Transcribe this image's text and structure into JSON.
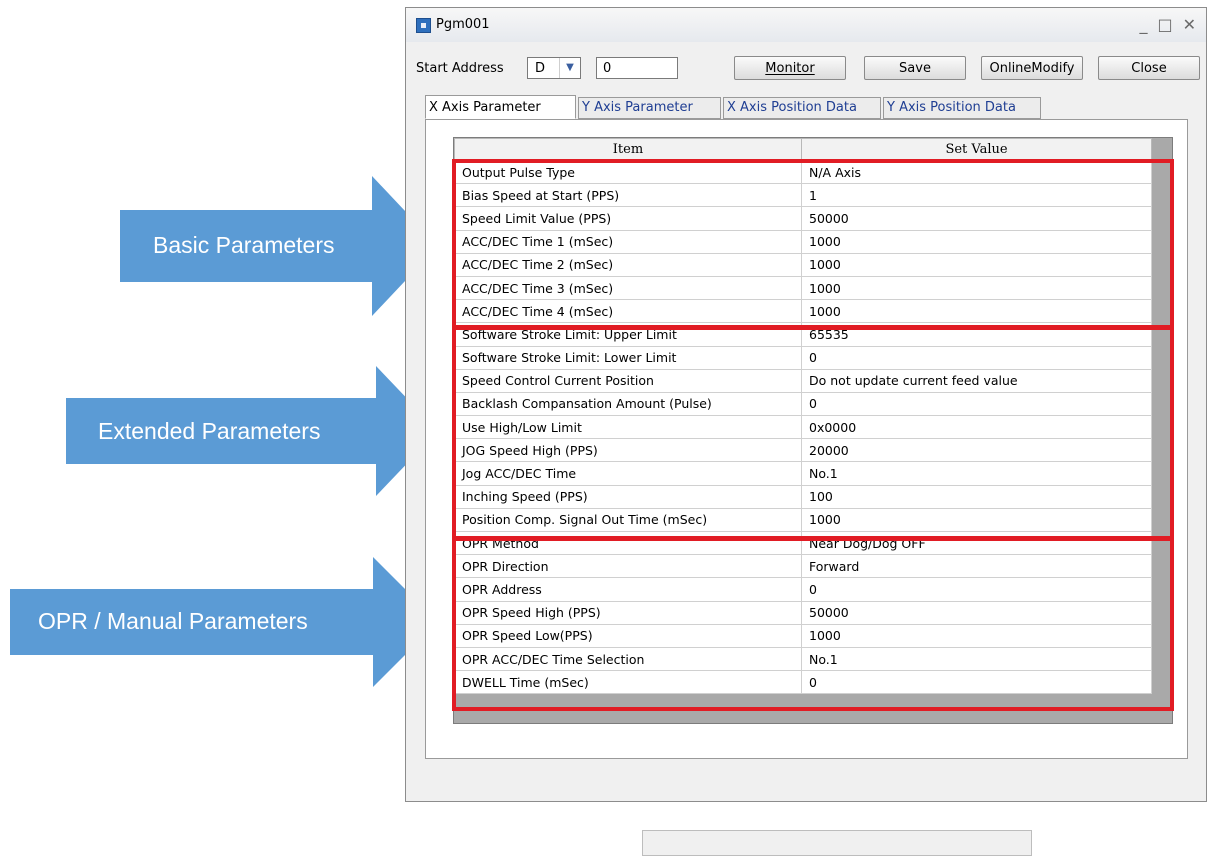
{
  "annotations": [
    {
      "label": "Basic Parameters"
    },
    {
      "label": "Extended Parameters"
    },
    {
      "label": "OPR / Manual Parameters"
    }
  ],
  "colors": {
    "arrow": "#5b9bd5",
    "highlight": "#e11c24",
    "tab_text": "#1f3e93"
  },
  "window": {
    "title": "Pgm001",
    "icon": "app-icon",
    "controls": {
      "minimize": "_",
      "maximize": "□",
      "close": "✕"
    }
  },
  "toolbar": {
    "start_address_label": "Start Address",
    "device_value": "D",
    "address_value": "0",
    "monitor_label": "Monitor",
    "save_label": "Save",
    "online_modify_label": "OnlineModify",
    "close_label": "Close"
  },
  "tabs": [
    {
      "label": "X Axis Parameter",
      "active": true
    },
    {
      "label": "Y Axis Parameter",
      "active": false
    },
    {
      "label": "X Axis Position Data",
      "active": false
    },
    {
      "label": "Y Axis Position Data",
      "active": false
    }
  ],
  "table": {
    "headers": [
      "Item",
      "Set Value"
    ],
    "rows": [
      {
        "item": "Output Pulse Type",
        "value": "N/A Axis"
      },
      {
        "item": "Bias Speed at Start (PPS)",
        "value": "1"
      },
      {
        "item": "Speed Limit Value (PPS)",
        "value": "50000"
      },
      {
        "item": "ACC/DEC Time 1 (mSec)",
        "value": "1000"
      },
      {
        "item": "ACC/DEC Time 2 (mSec)",
        "value": "1000"
      },
      {
        "item": "ACC/DEC Time 3 (mSec)",
        "value": "1000"
      },
      {
        "item": "ACC/DEC Time 4 (mSec)",
        "value": "1000"
      },
      {
        "item": "Software Stroke Limit: Upper Limit",
        "value": "65535"
      },
      {
        "item": "Software Stroke Limit: Lower Limit",
        "value": "0"
      },
      {
        "item": "Speed Control Current Position",
        "value": "Do not update current feed value"
      },
      {
        "item": "Backlash Compansation Amount (Pulse)",
        "value": "0"
      },
      {
        "item": "Use High/Low Limit",
        "value": "0x0000"
      },
      {
        "item": "JOG Speed High (PPS)",
        "value": "20000"
      },
      {
        "item": "Jog ACC/DEC Time",
        "value": "No.1"
      },
      {
        "item": "Inching Speed (PPS)",
        "value": "100"
      },
      {
        "item": "Position Comp. Signal Out Time (mSec)",
        "value": "1000"
      },
      {
        "item": "OPR Method",
        "value": "Near Dog/Dog OFF"
      },
      {
        "item": "OPR Direction",
        "value": "Forward"
      },
      {
        "item": "OPR Address",
        "value": "0"
      },
      {
        "item": "OPR Speed High (PPS)",
        "value": "50000"
      },
      {
        "item": "OPR Speed Low(PPS)",
        "value": "1000"
      },
      {
        "item": "OPR ACC/DEC Time Selection",
        "value": "No.1"
      },
      {
        "item": "DWELL Time (mSec)",
        "value": "0"
      }
    ]
  }
}
